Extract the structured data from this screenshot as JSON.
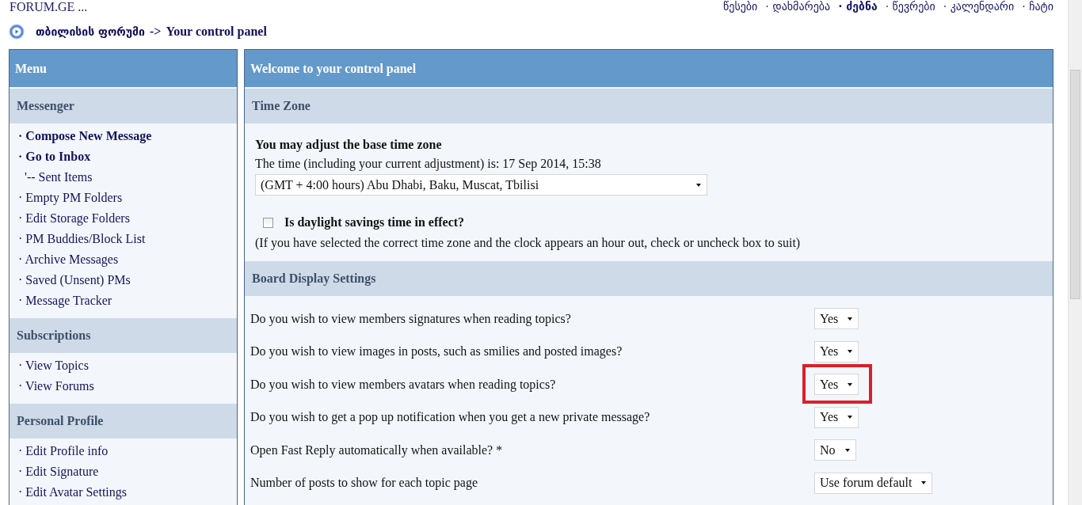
{
  "site_title": "FORUM.GE ...",
  "nav_links": [
    {
      "label": "წესები",
      "selected": false
    },
    {
      "label": "· დახმარება",
      "selected": false
    },
    {
      "label": "· ძებნა",
      "selected": true
    },
    {
      "label": "· წევრები",
      "selected": false
    },
    {
      "label": "· კალენდარი",
      "selected": false
    },
    {
      "label": "· ჩატი",
      "selected": false
    }
  ],
  "breadcrumb": {
    "forum": "თბილისის ფორუმი",
    "separator": "->",
    "page": "Your control panel"
  },
  "sidebar": {
    "title": "Menu",
    "sections": [
      {
        "title": "Messenger",
        "items": [
          {
            "label": "· Compose New Message",
            "kind": "strong"
          },
          {
            "label": "· Go to Inbox",
            "kind": "strong"
          },
          {
            "label": "'-- Sent Items",
            "kind": "sub"
          },
          {
            "label": "· Empty PM Folders",
            "kind": "normal"
          },
          {
            "label": "· Edit Storage Folders",
            "kind": "normal"
          },
          {
            "label": "· PM Buddies/Block List",
            "kind": "normal"
          },
          {
            "label": "· Archive Messages",
            "kind": "normal"
          },
          {
            "label": "· Saved (Unsent) PMs",
            "kind": "normal"
          },
          {
            "label": "· Message Tracker",
            "kind": "normal"
          }
        ]
      },
      {
        "title": "Subscriptions",
        "items": [
          {
            "label": "· View Topics",
            "kind": "normal"
          },
          {
            "label": "· View Forums",
            "kind": "normal"
          }
        ]
      },
      {
        "title": "Personal Profile",
        "items": [
          {
            "label": "· Edit Profile info",
            "kind": "normal"
          },
          {
            "label": "· Edit Signature",
            "kind": "normal"
          },
          {
            "label": "· Edit Avatar Settings",
            "kind": "normal"
          }
        ]
      }
    ]
  },
  "panel": {
    "title": "Welcome to your control panel",
    "time_zone": {
      "title": "Time Zone",
      "heading": "You may adjust the base time zone",
      "current_time": "The time (including your current adjustment) is: 17 Sep 2014, 15:38",
      "zone_select": "(GMT + 4:00 hours) Abu Dhabi, Baku, Muscat, Tbilisi",
      "dst_label": "Is daylight savings time in effect?",
      "dst_checked": false,
      "dst_note": "(If you have selected the correct time zone and the clock appears an hour out, check or uncheck box to suit)"
    },
    "board_display": {
      "title": "Board Display Settings",
      "settings": [
        {
          "question": "Do you wish to view members signatures when reading topics?",
          "value": "Yes",
          "highlighted": false
        },
        {
          "question": "Do you wish to view images in posts, such as smilies and posted images?",
          "value": "Yes",
          "highlighted": false
        },
        {
          "question": "Do you wish to view members avatars when reading topics?",
          "value": "Yes",
          "highlighted": true
        },
        {
          "question": "Do you wish to get a pop up notification when you get a new private message?",
          "value": "Yes",
          "highlighted": false
        },
        {
          "question": "Open Fast Reply automatically when available? *",
          "value": "No",
          "highlighted": false
        },
        {
          "question": "Number of posts to show for each topic page",
          "value": "Use forum default",
          "highlighted": false
        }
      ]
    }
  }
}
